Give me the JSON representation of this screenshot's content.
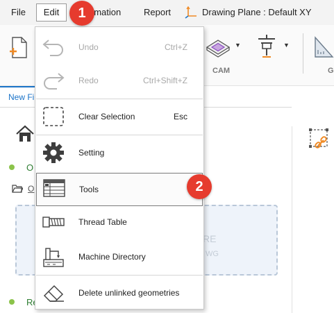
{
  "menubar": {
    "file": "File",
    "edit": "Edit",
    "automation": "omation",
    "report": "Report",
    "drawing_plane": "Drawing Plane : Default XY"
  },
  "toolbar": {
    "cam_label": "CAM",
    "g_label": "G"
  },
  "tabs": {
    "new_file": "New Fi"
  },
  "panel": {
    "item1": "O",
    "item2": "O",
    "item3": "Re",
    "dropzone_text1": "RE",
    "dropzone_text2": "WG"
  },
  "edit_menu": {
    "items": [
      {
        "label": "Undo",
        "shortcut": "Ctrl+Z",
        "enabled": false,
        "icon": "undo-icon"
      },
      {
        "label": "Redo",
        "shortcut": "Ctrl+Shift+Z",
        "enabled": false,
        "icon": "redo-icon"
      },
      {
        "label": "Clear Selection",
        "shortcut": "Esc",
        "enabled": true,
        "icon": "clear-selection-icon"
      },
      {
        "label": "Setting",
        "shortcut": "",
        "enabled": true,
        "icon": "gear-icon"
      },
      {
        "label": "Tools",
        "shortcut": "",
        "enabled": true,
        "icon": "tools-table-icon"
      },
      {
        "label": "Thread Table",
        "shortcut": "",
        "enabled": true,
        "icon": "thread-table-icon"
      },
      {
        "label": "Machine Directory",
        "shortcut": "",
        "enabled": true,
        "icon": "machine-directory-icon"
      },
      {
        "label": "Delete unlinked geometries",
        "shortcut": "",
        "enabled": true,
        "icon": "eraser-icon"
      }
    ]
  },
  "badges": {
    "step1": "1",
    "step2": "2"
  },
  "colors": {
    "badge": "#e63b2e",
    "accent": "#1a73c8",
    "orange": "#f08a24"
  }
}
